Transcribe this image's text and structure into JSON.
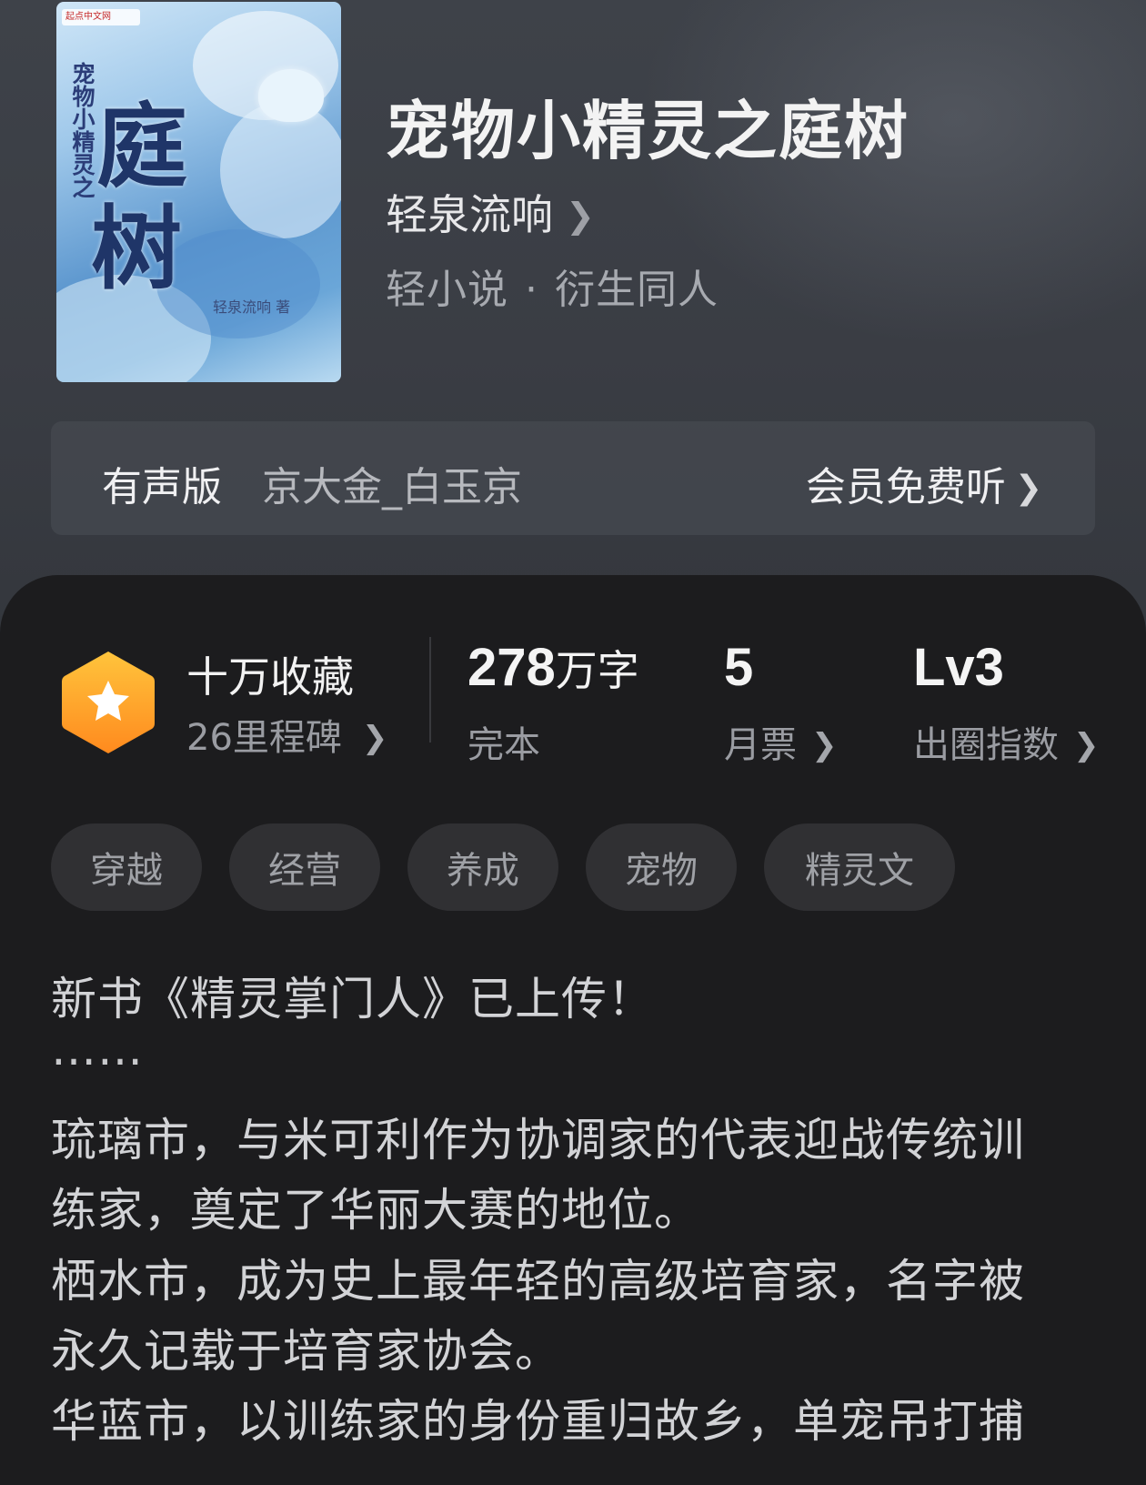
{
  "cover": {
    "publisher_text": "起点中文网",
    "subtitle": "宠物小精灵之",
    "big_char_1": "庭",
    "big_char_2": "树",
    "author_signature": "轻泉流响 著"
  },
  "book": {
    "title": "宠物小精灵之庭树",
    "author": "轻泉流响",
    "category": "轻小说",
    "subcategory": "衍生同人",
    "separator": "·"
  },
  "audio": {
    "label": "有声版",
    "narrator": "京大金_白玉京",
    "cta": "会员免费听"
  },
  "stats": {
    "favorites": "十万收藏",
    "milestones": "26里程碑",
    "word_count": "278",
    "word_unit": "万字",
    "status": "完本",
    "monthly_votes": "5",
    "monthly_votes_label": "月票",
    "influence_level": "Lv3",
    "influence_label": "出圈指数"
  },
  "tags": [
    "穿越",
    "经营",
    "养成",
    "宠物",
    "精灵文"
  ],
  "synopsis": [
    "新书《精灵掌门人》已上传！",
    "……",
    "琉璃市，与米可利作为协调家的代表迎战传统训",
    "练家，奠定了华丽大赛的地位。",
    "栖水市，成为史上最年轻的高级培育家，名字被",
    "永久记载于培育家协会。",
    "华蓝市，以训练家的身份重归故乡，单宠吊打捕"
  ],
  "icons": {
    "author_chevron": "chevron-right-icon",
    "audio_chevron": "chevron-right-icon",
    "badge": "star-hexagon-icon"
  },
  "colors": {
    "badge_gradient_top": "#ffc23a",
    "badge_gradient_bottom": "#ff8a1e",
    "panel_bg": "#1c1c1e",
    "hero_bg": "#3c3f46"
  }
}
